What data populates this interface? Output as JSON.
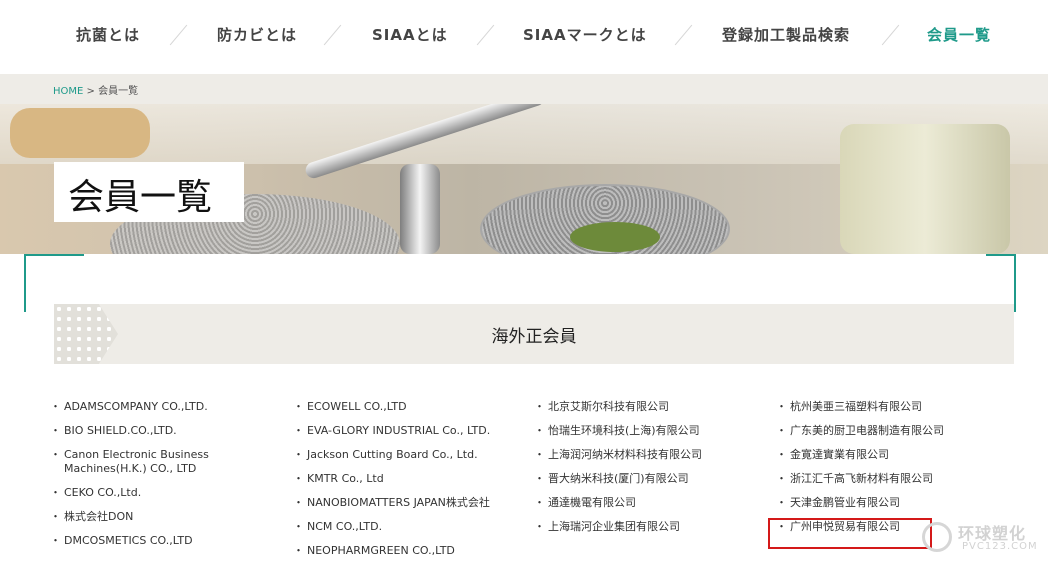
{
  "nav": {
    "items": [
      {
        "label": "抗菌とは"
      },
      {
        "label": "防カビとは"
      },
      {
        "label": "SIAAとは"
      },
      {
        "label": "SIAAマークとは"
      },
      {
        "label": "登録加工製品検索"
      },
      {
        "label": "会員一覧"
      }
    ],
    "active_color": "#1f9a8a"
  },
  "breadcrumb": {
    "home": "HOME",
    "separator": " > ",
    "current": "会員一覧"
  },
  "hero": {
    "title": "会員一覧"
  },
  "section": {
    "title": "海外正会員"
  },
  "members": {
    "col1": [
      "ADAMSCOMPANY CO.,LTD.",
      "BIO SHIELD.CO.,LTD.",
      "Canon Electronic Business Machines(H.K.) CO., LTD",
      "CEKO CO.,Ltd.",
      "株式会社DON",
      "DMCOSMETICS CO.,LTD"
    ],
    "col2": [
      "ECOWELL CO.,LTD",
      "EVA-GLORY INDUSTRIAL Co., LTD.",
      "Jackson Cutting Board Co., Ltd.",
      "KMTR Co., Ltd",
      "NANOBIOMATTERS JAPAN株式会社",
      "NCM CO.,LTD.",
      "NEOPHARMGREEN CO.,LTD"
    ],
    "col3": [
      "北京艾斯尔科技有限公司",
      "怡瑞生环境科技(上海)有限公司",
      "上海润河纳米材料科技有限公司",
      "晋大纳米科技(厦门)有限公司",
      "通達機電有限公司",
      "上海瑞河企业集团有限公司"
    ],
    "col4": [
      "杭州美亜三福塑料有限公司",
      "广东美的厨卫电器制造有限公司",
      "金寛達實業有限公司",
      "浙江汇千高飞新材料有限公司",
      "天津金鹏管业有限公司",
      "广州申悦贸易有限公司"
    ]
  },
  "watermark": {
    "text": "环球塑化",
    "sub": "PVC123.COM"
  },
  "colors": {
    "accent": "#1f9a8a",
    "highlight": "#d41919",
    "band": "#eeece7"
  }
}
